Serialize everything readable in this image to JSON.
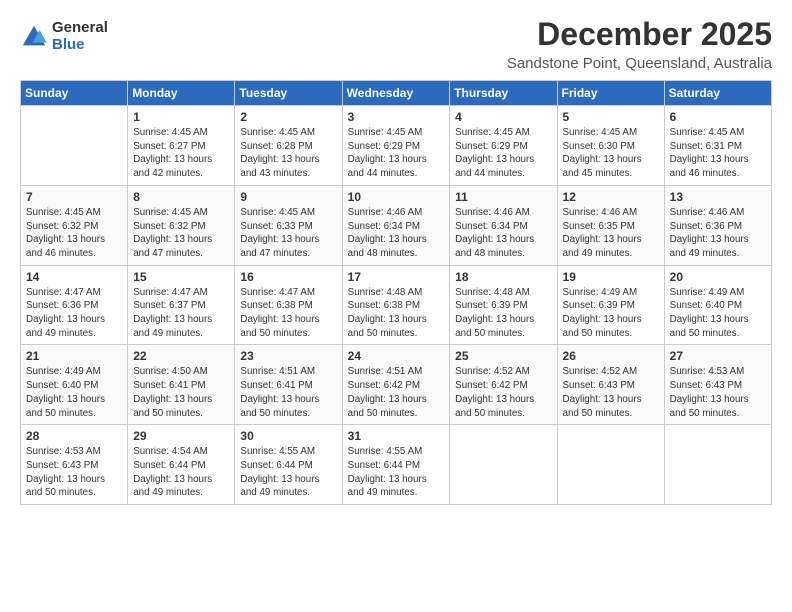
{
  "logo": {
    "general": "General",
    "blue": "Blue"
  },
  "header": {
    "month": "December 2025",
    "location": "Sandstone Point, Queensland, Australia"
  },
  "days_of_week": [
    "Sunday",
    "Monday",
    "Tuesday",
    "Wednesday",
    "Thursday",
    "Friday",
    "Saturday"
  ],
  "weeks": [
    [
      {
        "day": "",
        "info": ""
      },
      {
        "day": "1",
        "info": "Sunrise: 4:45 AM\nSunset: 6:27 PM\nDaylight: 13 hours\nand 42 minutes."
      },
      {
        "day": "2",
        "info": "Sunrise: 4:45 AM\nSunset: 6:28 PM\nDaylight: 13 hours\nand 43 minutes."
      },
      {
        "day": "3",
        "info": "Sunrise: 4:45 AM\nSunset: 6:29 PM\nDaylight: 13 hours\nand 44 minutes."
      },
      {
        "day": "4",
        "info": "Sunrise: 4:45 AM\nSunset: 6:29 PM\nDaylight: 13 hours\nand 44 minutes."
      },
      {
        "day": "5",
        "info": "Sunrise: 4:45 AM\nSunset: 6:30 PM\nDaylight: 13 hours\nand 45 minutes."
      },
      {
        "day": "6",
        "info": "Sunrise: 4:45 AM\nSunset: 6:31 PM\nDaylight: 13 hours\nand 46 minutes."
      }
    ],
    [
      {
        "day": "7",
        "info": "Sunrise: 4:45 AM\nSunset: 6:32 PM\nDaylight: 13 hours\nand 46 minutes."
      },
      {
        "day": "8",
        "info": "Sunrise: 4:45 AM\nSunset: 6:32 PM\nDaylight: 13 hours\nand 47 minutes."
      },
      {
        "day": "9",
        "info": "Sunrise: 4:45 AM\nSunset: 6:33 PM\nDaylight: 13 hours\nand 47 minutes."
      },
      {
        "day": "10",
        "info": "Sunrise: 4:46 AM\nSunset: 6:34 PM\nDaylight: 13 hours\nand 48 minutes."
      },
      {
        "day": "11",
        "info": "Sunrise: 4:46 AM\nSunset: 6:34 PM\nDaylight: 13 hours\nand 48 minutes."
      },
      {
        "day": "12",
        "info": "Sunrise: 4:46 AM\nSunset: 6:35 PM\nDaylight: 13 hours\nand 49 minutes."
      },
      {
        "day": "13",
        "info": "Sunrise: 4:46 AM\nSunset: 6:36 PM\nDaylight: 13 hours\nand 49 minutes."
      }
    ],
    [
      {
        "day": "14",
        "info": "Sunrise: 4:47 AM\nSunset: 6:36 PM\nDaylight: 13 hours\nand 49 minutes."
      },
      {
        "day": "15",
        "info": "Sunrise: 4:47 AM\nSunset: 6:37 PM\nDaylight: 13 hours\nand 49 minutes."
      },
      {
        "day": "16",
        "info": "Sunrise: 4:47 AM\nSunset: 6:38 PM\nDaylight: 13 hours\nand 50 minutes."
      },
      {
        "day": "17",
        "info": "Sunrise: 4:48 AM\nSunset: 6:38 PM\nDaylight: 13 hours\nand 50 minutes."
      },
      {
        "day": "18",
        "info": "Sunrise: 4:48 AM\nSunset: 6:39 PM\nDaylight: 13 hours\nand 50 minutes."
      },
      {
        "day": "19",
        "info": "Sunrise: 4:49 AM\nSunset: 6:39 PM\nDaylight: 13 hours\nand 50 minutes."
      },
      {
        "day": "20",
        "info": "Sunrise: 4:49 AM\nSunset: 6:40 PM\nDaylight: 13 hours\nand 50 minutes."
      }
    ],
    [
      {
        "day": "21",
        "info": "Sunrise: 4:49 AM\nSunset: 6:40 PM\nDaylight: 13 hours\nand 50 minutes."
      },
      {
        "day": "22",
        "info": "Sunrise: 4:50 AM\nSunset: 6:41 PM\nDaylight: 13 hours\nand 50 minutes."
      },
      {
        "day": "23",
        "info": "Sunrise: 4:51 AM\nSunset: 6:41 PM\nDaylight: 13 hours\nand 50 minutes."
      },
      {
        "day": "24",
        "info": "Sunrise: 4:51 AM\nSunset: 6:42 PM\nDaylight: 13 hours\nand 50 minutes."
      },
      {
        "day": "25",
        "info": "Sunrise: 4:52 AM\nSunset: 6:42 PM\nDaylight: 13 hours\nand 50 minutes."
      },
      {
        "day": "26",
        "info": "Sunrise: 4:52 AM\nSunset: 6:43 PM\nDaylight: 13 hours\nand 50 minutes."
      },
      {
        "day": "27",
        "info": "Sunrise: 4:53 AM\nSunset: 6:43 PM\nDaylight: 13 hours\nand 50 minutes."
      }
    ],
    [
      {
        "day": "28",
        "info": "Sunrise: 4:53 AM\nSunset: 6:43 PM\nDaylight: 13 hours\nand 50 minutes."
      },
      {
        "day": "29",
        "info": "Sunrise: 4:54 AM\nSunset: 6:44 PM\nDaylight: 13 hours\nand 49 minutes."
      },
      {
        "day": "30",
        "info": "Sunrise: 4:55 AM\nSunset: 6:44 PM\nDaylight: 13 hours\nand 49 minutes."
      },
      {
        "day": "31",
        "info": "Sunrise: 4:55 AM\nSunset: 6:44 PM\nDaylight: 13 hours\nand 49 minutes."
      },
      {
        "day": "",
        "info": ""
      },
      {
        "day": "",
        "info": ""
      },
      {
        "day": "",
        "info": ""
      }
    ]
  ]
}
